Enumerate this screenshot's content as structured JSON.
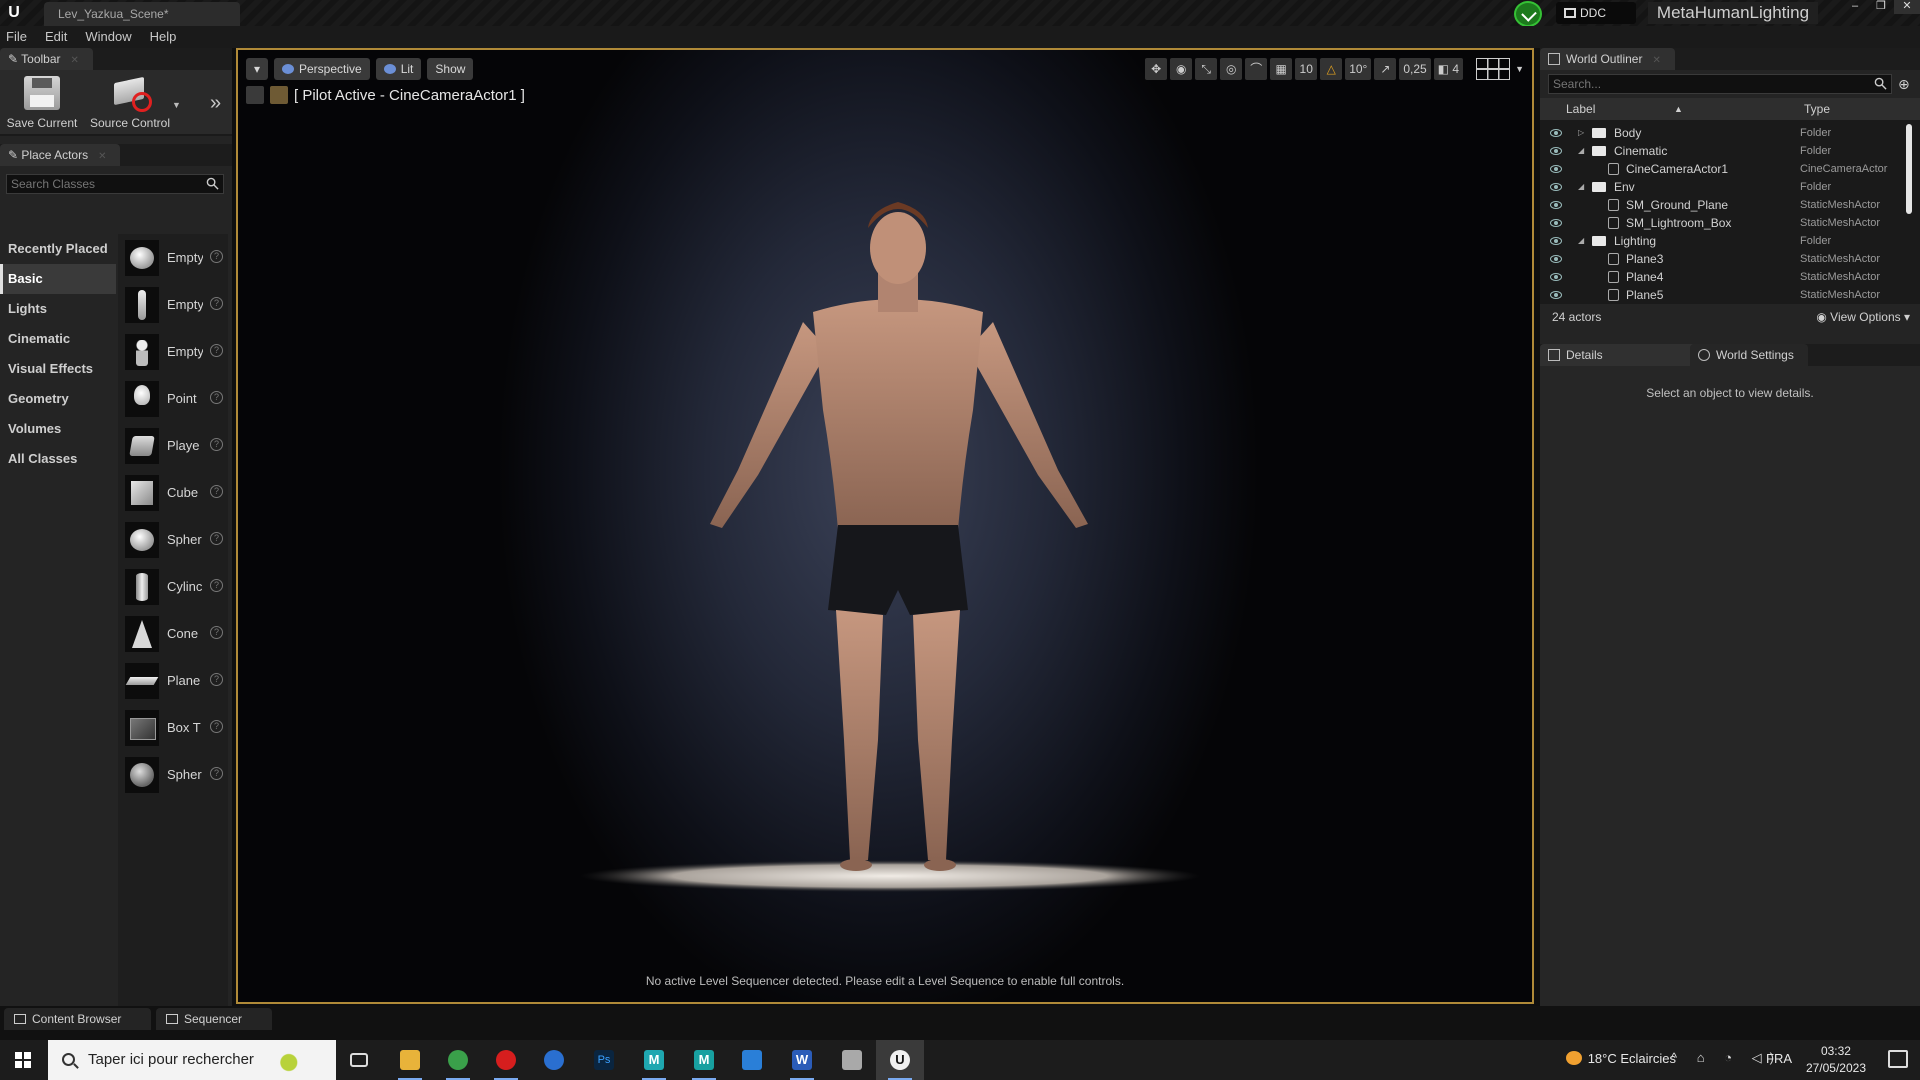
{
  "window": {
    "level_tab": "Lev_Yazkua_Scene*",
    "ddc_label": "DDC",
    "project_name": "MetaHumanLighting",
    "controls": [
      "–",
      "❐",
      "✕"
    ]
  },
  "menu": [
    "File",
    "Edit",
    "Window",
    "Help"
  ],
  "toolbar": {
    "tab_title": "Toolbar",
    "save_label": "Save Current",
    "source_control_label": "Source Control"
  },
  "place_actors": {
    "tab_title": "Place Actors",
    "search_placeholder": "Search Classes",
    "categories": [
      "Recently Placed",
      "Basic",
      "Lights",
      "Cinematic",
      "Visual Effects",
      "Geometry",
      "Volumes",
      "All Classes"
    ],
    "active_category": "Basic",
    "items": [
      {
        "label": "Empty",
        "icon": "empty-actor-icon"
      },
      {
        "label": "Empty",
        "icon": "empty-character-icon"
      },
      {
        "label": "Empty",
        "icon": "empty-pawn-icon"
      },
      {
        "label": "Point",
        "icon": "point-light-icon"
      },
      {
        "label": "Playe",
        "icon": "player-start-icon"
      },
      {
        "label": "Cube",
        "icon": "cube-icon"
      },
      {
        "label": "Spher",
        "icon": "sphere-icon"
      },
      {
        "label": "Cylinc",
        "icon": "cylinder-icon"
      },
      {
        "label": "Cone",
        "icon": "cone-icon"
      },
      {
        "label": "Plane",
        "icon": "plane-icon"
      },
      {
        "label": "Box T",
        "icon": "box-trigger-icon"
      },
      {
        "label": "Spher",
        "icon": "sphere-trigger-icon"
      }
    ],
    "help_glyph": "?"
  },
  "viewport": {
    "perspective_label": "Perspective",
    "lit_label": "Lit",
    "show_label": "Show",
    "pilot_label": "[ Pilot Active - CineCameraActor1 ]",
    "grid_snap": "10",
    "rotation_snap": "10°",
    "scale_snap": "0,25",
    "camera_speed": "4",
    "sequencer_message": "No active Level Sequencer detected. Please edit a Level Sequence to enable full controls."
  },
  "outliner": {
    "tab_title": "World Outliner",
    "search_placeholder": "Search...",
    "col_label": "Label",
    "col_type": "Type",
    "rows": [
      {
        "name": "Body",
        "type": "Folder",
        "depth": 0,
        "kind": "folder",
        "expanded": false
      },
      {
        "name": "Cinematic",
        "type": "Folder",
        "depth": 0,
        "kind": "folder",
        "expanded": true
      },
      {
        "name": "CineCameraActor1",
        "type": "CineCameraActor",
        "depth": 1,
        "kind": "actor"
      },
      {
        "name": "Env",
        "type": "Folder",
        "depth": 0,
        "kind": "folder",
        "expanded": true
      },
      {
        "name": "SM_Ground_Plane",
        "type": "StaticMeshActor",
        "depth": 1,
        "kind": "actor"
      },
      {
        "name": "SM_Lightroom_Box",
        "type": "StaticMeshActor",
        "depth": 1,
        "kind": "actor"
      },
      {
        "name": "Lighting",
        "type": "Folder",
        "depth": 0,
        "kind": "folder",
        "expanded": true
      },
      {
        "name": "Plane3",
        "type": "StaticMeshActor",
        "depth": 1,
        "kind": "actor"
      },
      {
        "name": "Plane4",
        "type": "StaticMeshActor",
        "depth": 1,
        "kind": "actor"
      },
      {
        "name": "Plane5",
        "type": "StaticMeshActor",
        "depth": 1,
        "kind": "actor"
      }
    ],
    "actor_count": "24 actors",
    "view_options": "View Options"
  },
  "details": {
    "tab_title": "Details",
    "world_settings_title": "World Settings",
    "empty_message": "Select an object to view details."
  },
  "drawer": {
    "content_browser": "Content Browser",
    "sequencer": "Sequencer"
  },
  "taskbar": {
    "search_placeholder": "Taper ici pour rechercher",
    "weather": "18°C  Eclaircies",
    "language": "FRA",
    "time": "03:32",
    "date": "27/05/2023",
    "tray_glyphs": "^ ⌂ ◔ ◁)",
    "apps": [
      {
        "icon": "task-view-icon",
        "color": "#1c1c1c"
      },
      {
        "icon": "file-explorer-icon",
        "color": "#e8b33a"
      },
      {
        "icon": "chrome-icon",
        "color": "#3aa04a"
      },
      {
        "icon": "opera-icon",
        "color": "#d61e1e"
      },
      {
        "icon": "cinema4d-icon",
        "color": "#2a6fd0"
      },
      {
        "icon": "photoshop-icon",
        "color": "#0a2540"
      },
      {
        "icon": "maya-icon",
        "color": "#1fa7b0"
      },
      {
        "icon": "mari-icon",
        "color": "#18a0a0"
      },
      {
        "icon": "calculator-icon",
        "color": "#2a7fd8"
      },
      {
        "icon": "word-icon",
        "color": "#2b5cb8"
      },
      {
        "icon": "folder-app-icon",
        "color": "#a9a9a9"
      },
      {
        "icon": "unreal-engine-icon",
        "color": "#f0f0f0"
      }
    ]
  }
}
